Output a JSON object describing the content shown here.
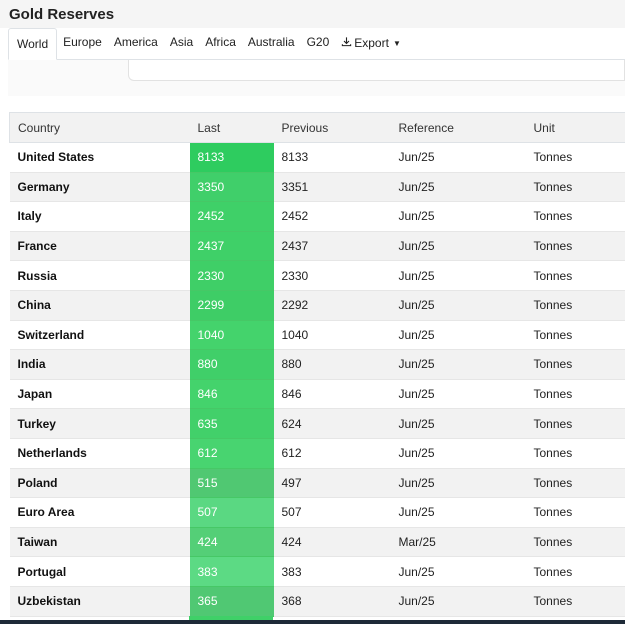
{
  "title": "Gold Reserves",
  "tabs": [
    {
      "label": "World",
      "active": true
    },
    {
      "label": "Europe"
    },
    {
      "label": "America"
    },
    {
      "label": "Asia"
    },
    {
      "label": "Africa"
    },
    {
      "label": "Australia"
    },
    {
      "label": "G20"
    }
  ],
  "export_label": "Export",
  "table": {
    "headers": [
      "Country",
      "Last",
      "Previous",
      "Reference",
      "Unit"
    ],
    "rows": [
      {
        "country": "United States",
        "last": "8133",
        "previous": "8133",
        "reference": "Jun/25",
        "unit": "Tonnes",
        "color": "#2ecc5f"
      },
      {
        "country": "Germany",
        "last": "3350",
        "previous": "3351",
        "reference": "Jun/25",
        "unit": "Tonnes",
        "color": "#40cf6a"
      },
      {
        "country": "Italy",
        "last": "2452",
        "previous": "2452",
        "reference": "Jun/25",
        "unit": "Tonnes",
        "color": "#3fd068"
      },
      {
        "country": "France",
        "last": "2437",
        "previous": "2437",
        "reference": "Jun/25",
        "unit": "Tonnes",
        "color": "#3fd068"
      },
      {
        "country": "Russia",
        "last": "2330",
        "previous": "2330",
        "reference": "Jun/25",
        "unit": "Tonnes",
        "color": "#3fcf67"
      },
      {
        "country": "China",
        "last": "2299",
        "previous": "2292",
        "reference": "Jun/25",
        "unit": "Tonnes",
        "color": "#3ecd66"
      },
      {
        "country": "Switzerland",
        "last": "1040",
        "previous": "1040",
        "reference": "Jun/25",
        "unit": "Tonnes",
        "color": "#44d36c"
      },
      {
        "country": "India",
        "last": "880",
        "previous": "880",
        "reference": "Jun/25",
        "unit": "Tonnes",
        "color": "#40cf69"
      },
      {
        "country": "Japan",
        "last": "846",
        "previous": "846",
        "reference": "Jun/25",
        "unit": "Tonnes",
        "color": "#44d36c"
      },
      {
        "country": "Turkey",
        "last": "635",
        "previous": "624",
        "reference": "Jun/25",
        "unit": "Tonnes",
        "color": "#42d06a"
      },
      {
        "country": "Netherlands",
        "last": "612",
        "previous": "612",
        "reference": "Jun/25",
        "unit": "Tonnes",
        "color": "#48d470"
      },
      {
        "country": "Poland",
        "last": "515",
        "previous": "497",
        "reference": "Jun/25",
        "unit": "Tonnes",
        "color": "#50c872"
      },
      {
        "country": "Euro Area",
        "last": "507",
        "previous": "507",
        "reference": "Jun/25",
        "unit": "Tonnes",
        "color": "#5ad882"
      },
      {
        "country": "Taiwan",
        "last": "424",
        "previous": "424",
        "reference": "Mar/25",
        "unit": "Tonnes",
        "color": "#54cf77"
      },
      {
        "country": "Portugal",
        "last": "383",
        "previous": "383",
        "reference": "Jun/25",
        "unit": "Tonnes",
        "color": "#5cda84"
      },
      {
        "country": "Uzbekistan",
        "last": "365",
        "previous": "368",
        "reference": "Jun/25",
        "unit": "Tonnes",
        "color": "#50c873"
      }
    ]
  }
}
